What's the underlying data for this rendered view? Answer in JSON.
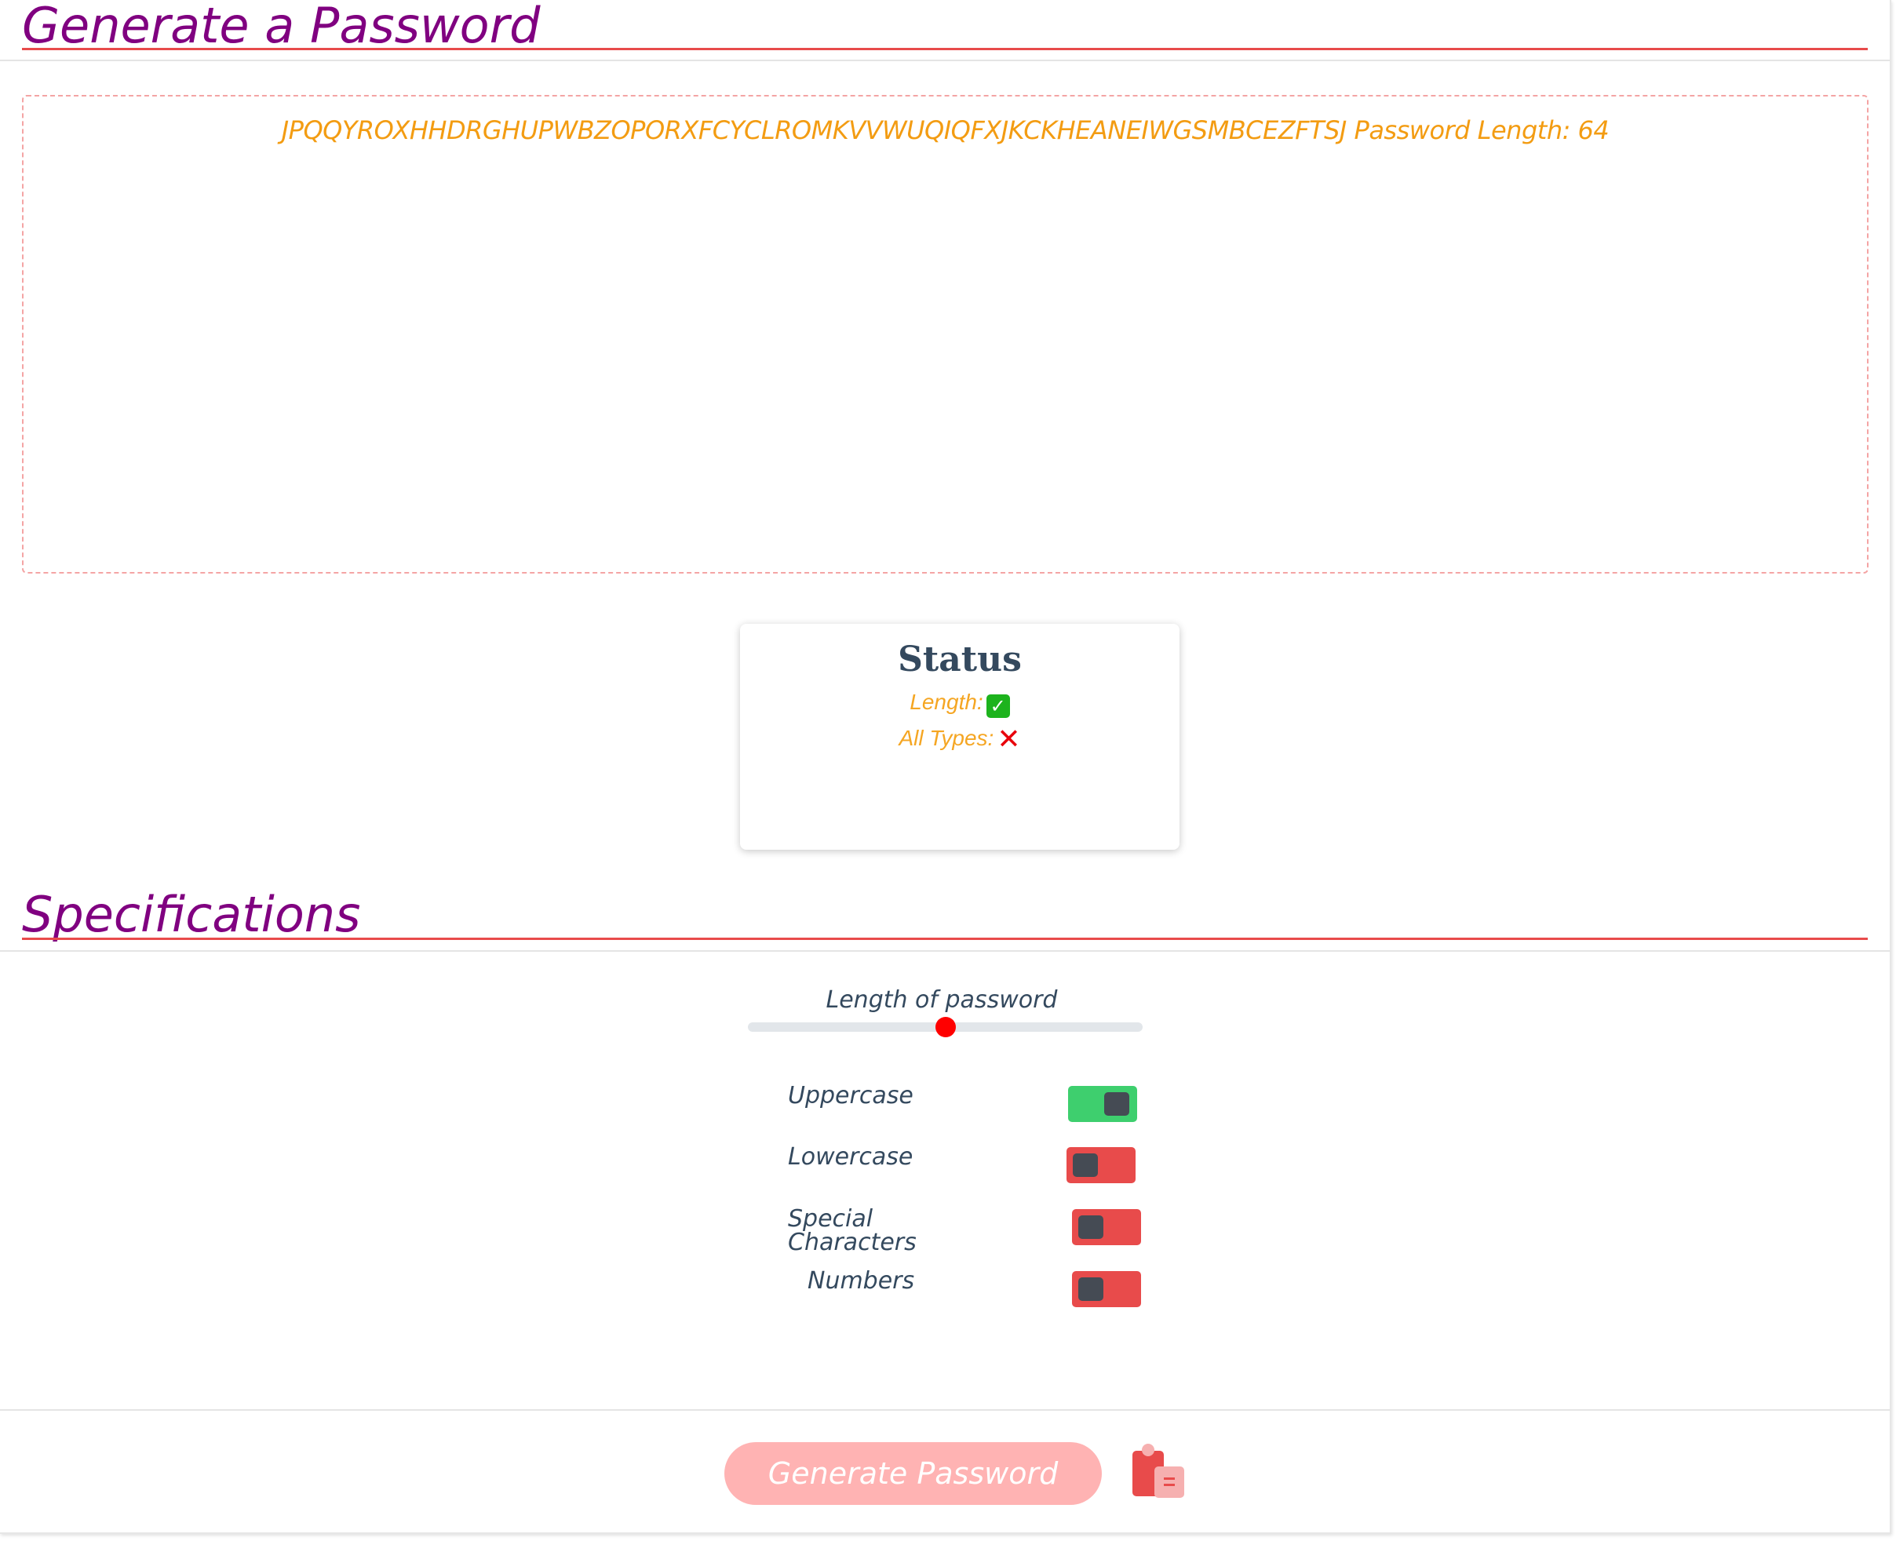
{
  "header": {
    "title": "Generate a Password"
  },
  "password_output": {
    "value": "JPQQYROXHHDRGHUPWBZOPORXFCYCLROMKVVWUQIQFXJKCKHEANEIWGSMBCEZFTSJ",
    "length_label": "Password Length: 64"
  },
  "status": {
    "title": "Status",
    "length_label": "Length:",
    "length_ok": true,
    "all_types_label": "All Types:",
    "all_types_ok": false
  },
  "specifications": {
    "title": "Specifications",
    "slider": {
      "label": "Length of password",
      "fraction": 0.5
    },
    "options": [
      {
        "label": "Uppercase",
        "enabled": true
      },
      {
        "label": "Lowercase",
        "enabled": false
      },
      {
        "label": "Special Characters",
        "enabled": false
      },
      {
        "label": "Numbers",
        "enabled": false
      }
    ]
  },
  "actions": {
    "generate_label": "Generate Password",
    "copy_icon": "clipboard-icon"
  },
  "colors": {
    "title": "#800080",
    "accent_line": "#e84b4b",
    "password_text": "#f39c12",
    "toggle_on": "#3ecf6e",
    "toggle_off": "#e84b4b",
    "button": "#ffb3b3"
  }
}
